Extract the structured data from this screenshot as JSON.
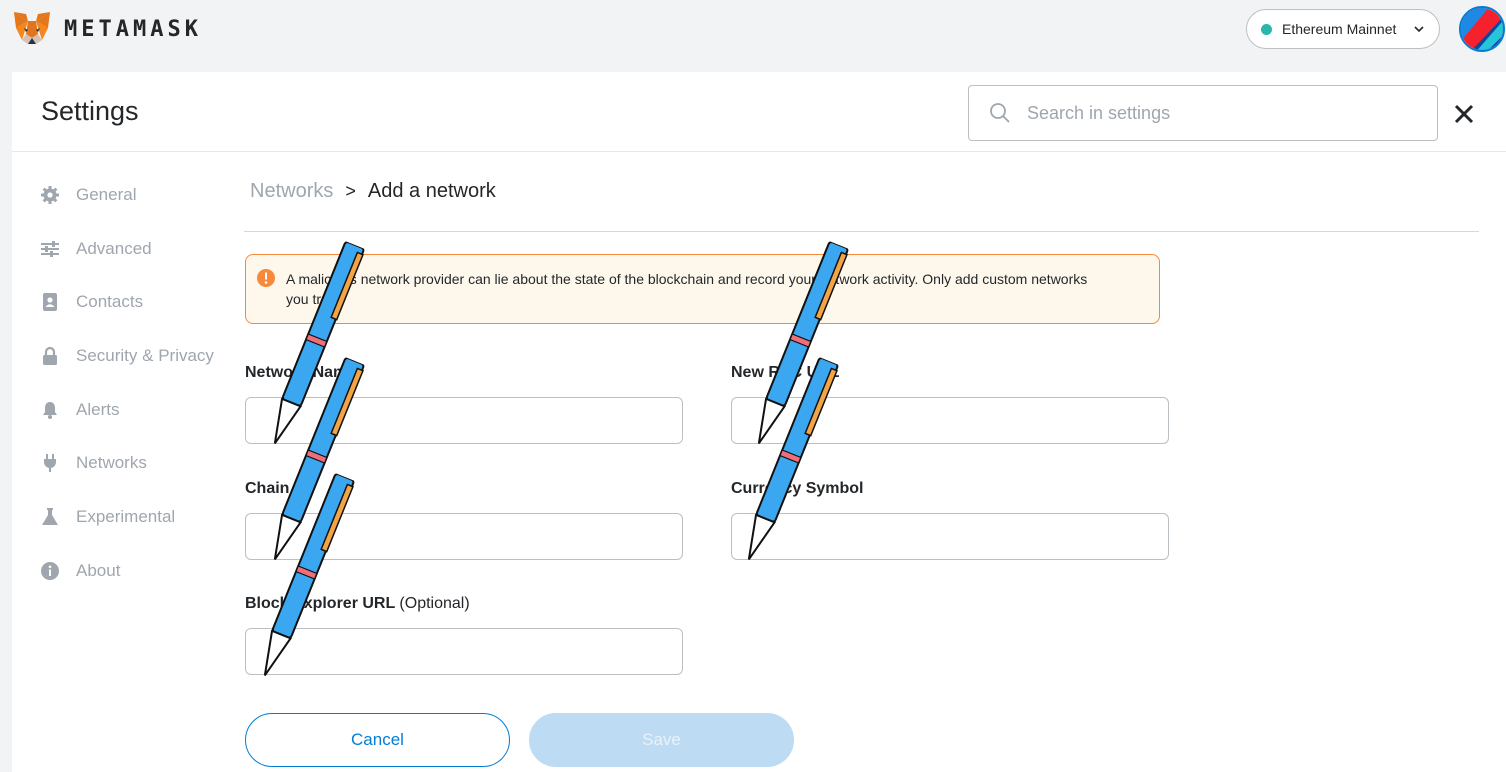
{
  "app": {
    "brand": "METAMASK",
    "network": "Ethereum Mainnet",
    "network_dot_color": "#29b6af",
    "accent": "#037dd6"
  },
  "settings": {
    "title": "Settings",
    "search_placeholder": "Search in settings"
  },
  "sidebar": {
    "items": [
      {
        "label": "General",
        "icon": "gear-icon"
      },
      {
        "label": "Advanced",
        "icon": "sliders-icon"
      },
      {
        "label": "Contacts",
        "icon": "contact-book-icon"
      },
      {
        "label": "Security & Privacy",
        "icon": "lock-icon"
      },
      {
        "label": "Alerts",
        "icon": "bell-icon"
      },
      {
        "label": "Networks",
        "icon": "plug-icon"
      },
      {
        "label": "Experimental",
        "icon": "flask-icon"
      },
      {
        "label": "About",
        "icon": "info-icon"
      }
    ]
  },
  "breadcrumb": {
    "root": "Networks",
    "separator": ">",
    "current": "Add a network"
  },
  "warning": {
    "text": "A malicious network provider can lie about the state of the blockchain and record your network activity. Only add custom networks you trust.",
    "color": "#f8883b"
  },
  "form": {
    "network_name": {
      "label": "Network Name",
      "value": ""
    },
    "rpc_url": {
      "label": "New RPC URL",
      "value": ""
    },
    "chain_id": {
      "label": "Chain ID",
      "value": ""
    },
    "currency_symbol": {
      "label": "Currency Symbol",
      "value": ""
    },
    "block_explorer": {
      "label": "Block Explorer URL",
      "optional": "(Optional)",
      "value": ""
    }
  },
  "buttons": {
    "cancel": "Cancel",
    "save": "Save"
  }
}
